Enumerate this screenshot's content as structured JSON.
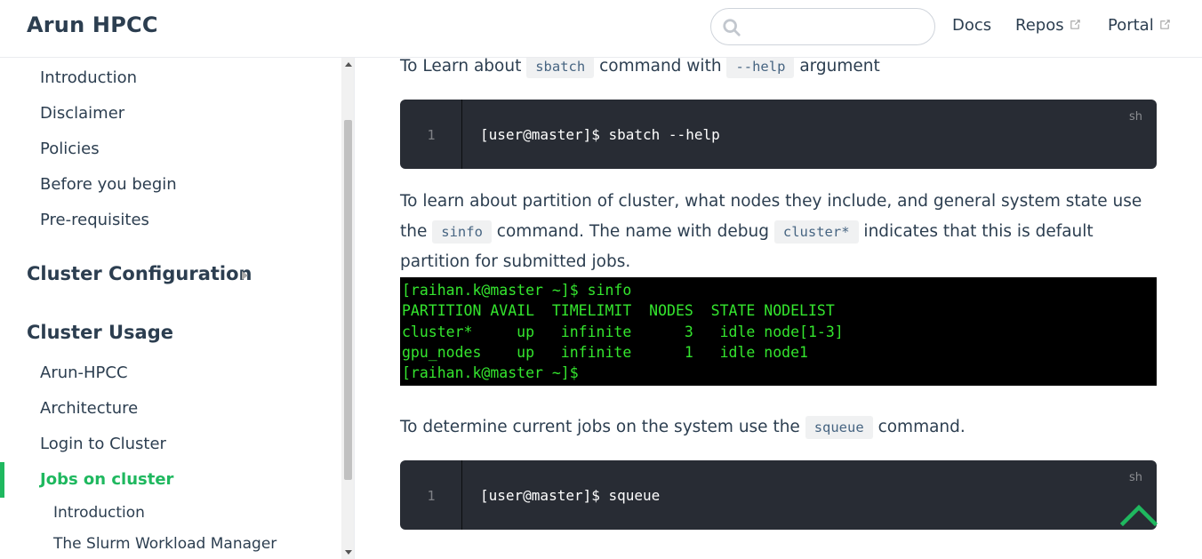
{
  "navbar": {
    "site_name": "Arun HPCC",
    "search": {
      "placeholder": "",
      "value": ""
    },
    "links": [
      {
        "label": "Docs",
        "external": false
      },
      {
        "label": "Repos",
        "external": true
      },
      {
        "label": "Portal",
        "external": true
      }
    ]
  },
  "sidebar": {
    "intro_items": [
      "Introduction",
      "Disclaimer",
      "Policies",
      "Before you begin",
      "Pre-requisites"
    ],
    "group_config": "Cluster Configuration",
    "group_usage": "Cluster Usage",
    "usage_items": [
      "Arun-HPCC",
      "Architecture",
      "Login to Cluster",
      "Jobs on cluster"
    ],
    "active_item": "Jobs on cluster",
    "sub_items": [
      "Introduction",
      "The Slurm Workload Manager"
    ]
  },
  "content": {
    "p1": {
      "before": "To Learn about ",
      "code1": "sbatch",
      "mid": " command with ",
      "code2": "--help",
      "after": " argument"
    },
    "code_block_1": {
      "line": "1",
      "code": "[user@master]$ sbatch --help",
      "lang": "sh"
    },
    "p2": {
      "before": "To learn about partition of cluster, what nodes they include, and general system state use the ",
      "code1": "sinfo",
      "mid": " command. The name with debug ",
      "code2": "cluster*",
      "after": " indicates that this is default partition for submitted jobs."
    },
    "terminal": {
      "lines": [
        "[raihan.k@master ~]$ sinfo",
        "PARTITION AVAIL  TIMELIMIT  NODES  STATE NODELIST",
        "cluster*     up   infinite      3   idle node[1-3]",
        "gpu_nodes    up   infinite      1   idle node1",
        "[raihan.k@master ~]$"
      ]
    },
    "p3": {
      "before": "To determine current jobs on the system use the ",
      "code1": "squeue",
      "after": " command."
    },
    "code_block_2": {
      "line": "1",
      "code": "[user@master]$ squeue",
      "lang": "sh"
    }
  },
  "colors": {
    "accent": "#1fb85f",
    "text": "#2c3e50",
    "code_bg": "#282c34",
    "terminal_green": "#34e52e"
  },
  "icons": {
    "search": "search-icon",
    "external": "external-link-icon",
    "back_to_top": "chevron-up-icon"
  }
}
